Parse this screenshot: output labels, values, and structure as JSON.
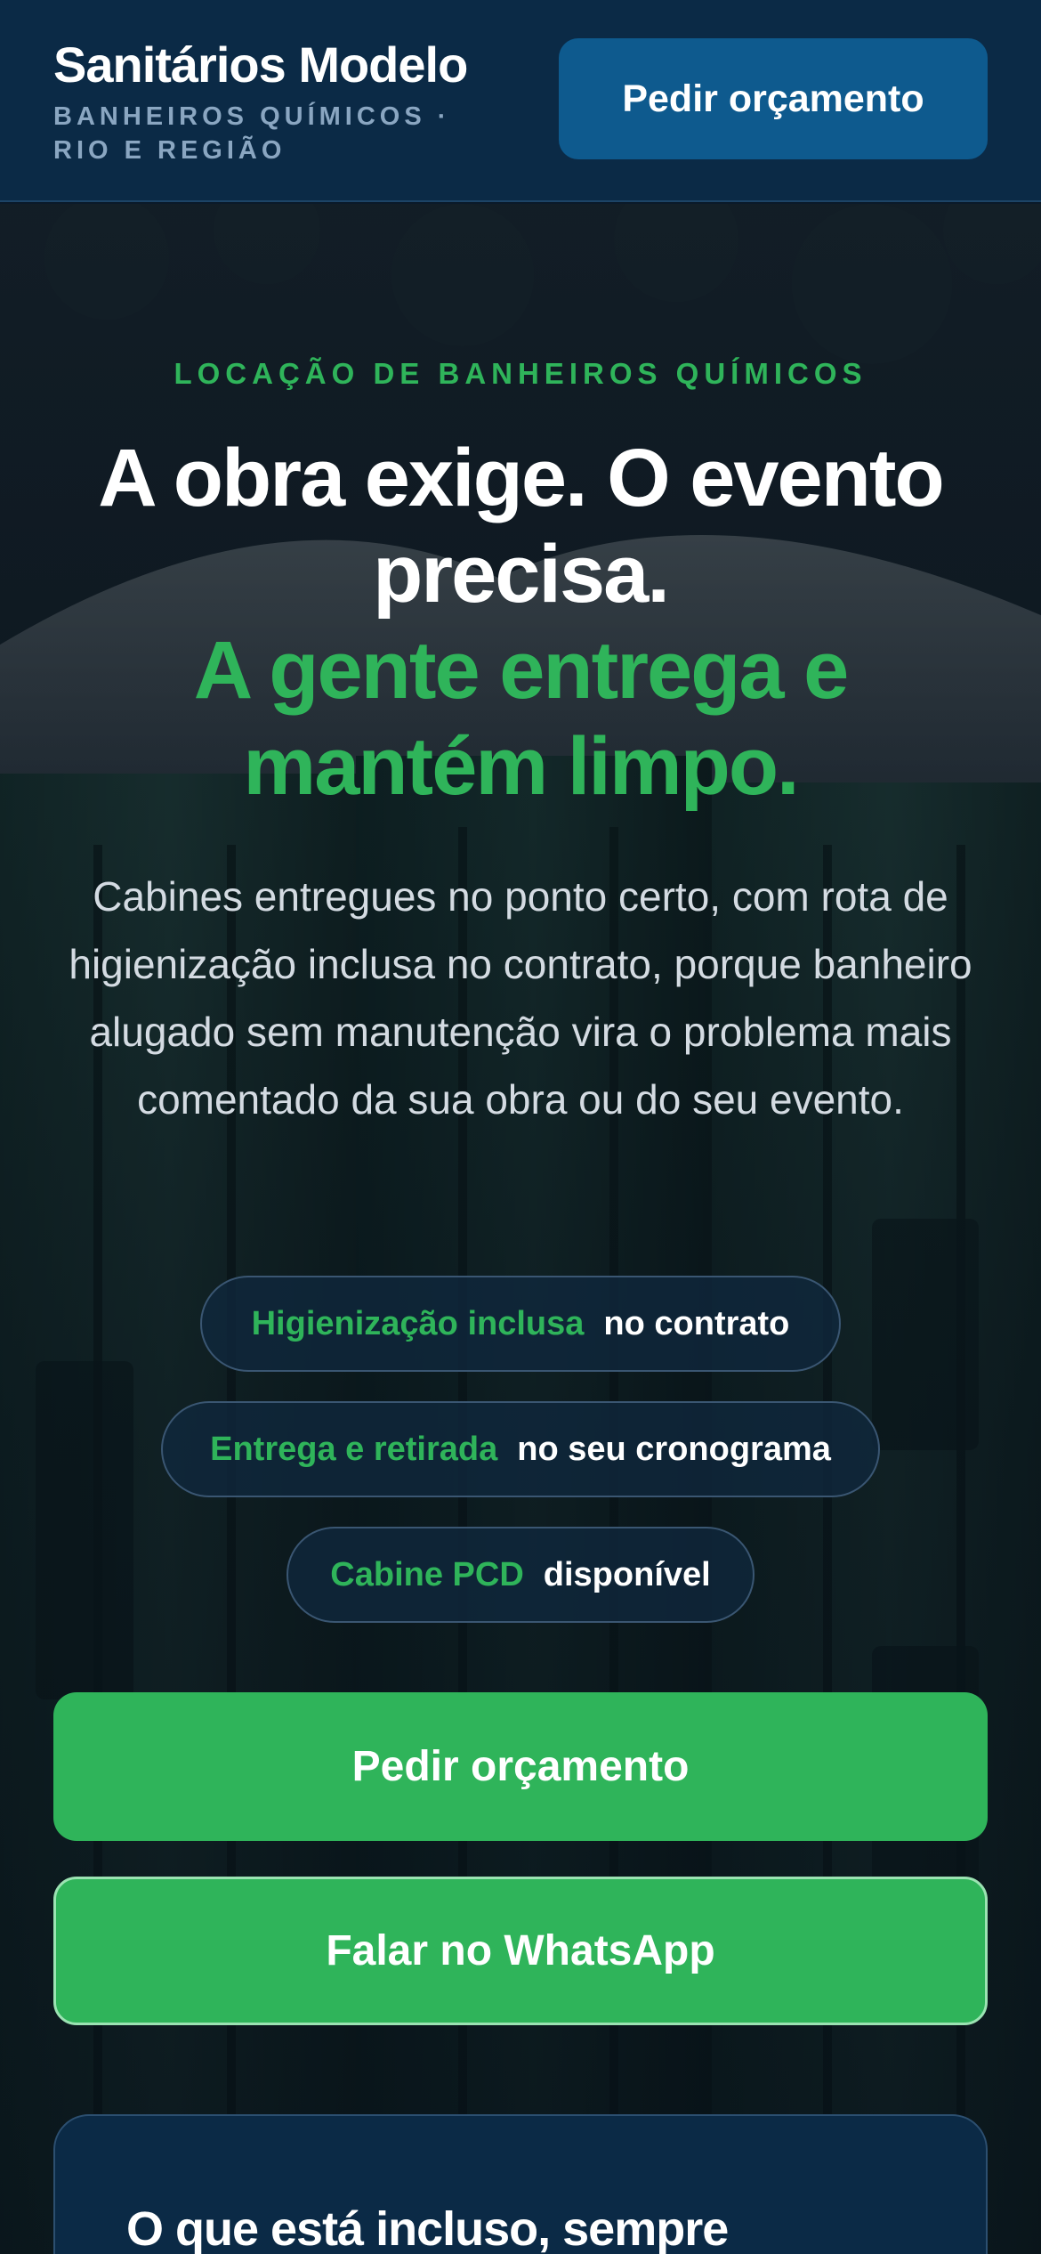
{
  "header": {
    "brand": "Sanitários Modelo",
    "tagline": "BANHEIROS QUÍMICOS · RIO E REGIÃO",
    "cta_label": "Pedir orçamento"
  },
  "hero": {
    "eyebrow": "LOCAÇÃO DE BANHEIROS QUÍMICOS",
    "headline_line1": "A obra exige. O evento precisa.",
    "headline_line2": "A gente entrega e mantém limpo.",
    "lede": "Cabines entregues no ponto certo, com rota de higienização inclusa no contrato, porque banheiro alugado sem manutenção vira o problema mais comentado da sua obra ou do seu evento.",
    "pills": [
      {
        "key": "Higienização inclusa",
        "value": "no contrato"
      },
      {
        "key": "Entrega e retirada",
        "value": "no seu cronograma"
      },
      {
        "key": "Cabine PCD",
        "value": "disponível"
      }
    ],
    "primary_cta": "Pedir orçamento",
    "secondary_cta": "Falar no WhatsApp"
  },
  "included": {
    "title": "O que está incluso, sempre"
  },
  "colors": {
    "accent_green": "#2fb45a",
    "header_navy": "#0b2a46",
    "header_button_blue": "#0e5a8e"
  },
  "icons": {
    "background": "portable-toilet-photo"
  }
}
